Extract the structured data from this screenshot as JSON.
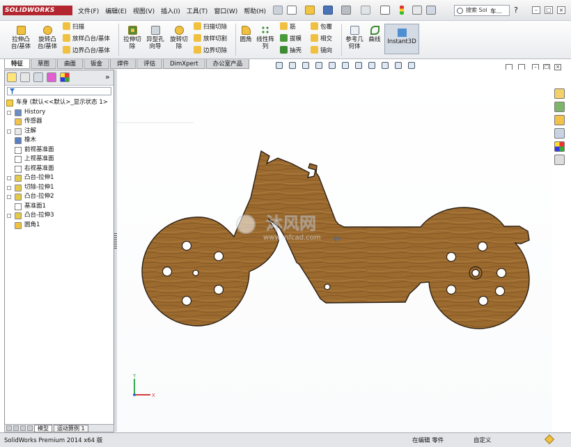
{
  "app": {
    "logo": "SOLIDWORKS",
    "menus": [
      "文件(F)",
      "编辑(E)",
      "视图(V)",
      "插入(I)",
      "工具(T)",
      "窗口(W)",
      "帮助(H)"
    ],
    "search_placeholder": "搜索 Sol",
    "extra_label": "车..."
  },
  "toolbar": {
    "extrude_boss": "拉伸凸\n台/基体",
    "revolve_boss": "旋转凸\n台/基体",
    "sweep": "扫描",
    "loft_boss": "放样凸台/基体",
    "boundary_boss": "边界凸台/基体",
    "extrude_cut": "拉伸切\n除",
    "hole_wizard": "异型孔\n向导",
    "revolve_cut": "旋转切\n除",
    "sweep_cut": "扫描切除",
    "loft_cut": "放样切割",
    "boundary_cut": "边界切除",
    "fillet": "圆角",
    "linear_pattern": "线性阵\n列",
    "rib": "筋",
    "draft": "拔模",
    "shell": "抽壳",
    "wrap": "包覆",
    "intersect": "相交",
    "mirror": "镜向",
    "ref_geometry": "参考几\n何体",
    "curves": "曲线",
    "instant3d": "Instant3D"
  },
  "tabs": [
    {
      "label": "特征",
      "active": true
    },
    {
      "label": "草图",
      "active": false
    },
    {
      "label": "曲面",
      "active": false
    },
    {
      "label": "钣金",
      "active": false
    },
    {
      "label": "焊件",
      "active": false
    },
    {
      "label": "评估",
      "active": false
    },
    {
      "label": "DimXpert",
      "active": false
    },
    {
      "label": "办公室产品",
      "active": false
    }
  ],
  "tree": {
    "root": "车身 (默认<<默认>_显示状态 1>",
    "items": [
      {
        "label": "History",
        "expand": true,
        "icon": "history-icon",
        "color": "#6a8ec4"
      },
      {
        "label": "传感器",
        "expand": false,
        "icon": "sensor-icon",
        "color": "#f2c24a"
      },
      {
        "label": "注解",
        "expand": true,
        "icon": "annotation-icon",
        "color": "#e8e8e8"
      },
      {
        "label": "橡木",
        "expand": false,
        "icon": "material-icon",
        "color": "#5a7fc2"
      },
      {
        "label": "前视基准面",
        "expand": false,
        "icon": "plane-icon",
        "color": "#ffffff"
      },
      {
        "label": "上视基准面",
        "expand": false,
        "icon": "plane-icon",
        "color": "#ffffff"
      },
      {
        "label": "右视基准面",
        "expand": false,
        "icon": "plane-icon",
        "color": "#ffffff"
      },
      {
        "label": "凸台-拉伸1",
        "expand": true,
        "icon": "extrude-icon",
        "color": "#e3c94c"
      },
      {
        "label": "切除-拉伸1",
        "expand": true,
        "icon": "cut-extrude-icon",
        "color": "#e3c94c"
      },
      {
        "label": "凸台-拉伸2",
        "expand": true,
        "icon": "extrude-icon",
        "color": "#e3c94c"
      },
      {
        "label": "基准面1",
        "expand": false,
        "icon": "plane-icon",
        "color": "#ffffff"
      },
      {
        "label": "凸台-拉伸3",
        "expand": true,
        "icon": "extrude-icon",
        "color": "#e3c94c"
      },
      {
        "label": "圆角1",
        "expand": false,
        "icon": "fillet-icon",
        "color": "#f0c13a"
      }
    ]
  },
  "panel_bottom": {
    "model_tab": "模型",
    "motion_tab": "运动算例 1"
  },
  "watermark": {
    "brand": "沐风网",
    "url": "www.mfcad.com"
  },
  "triad": {
    "y": "Y",
    "x": "X"
  },
  "status": {
    "product": "SolidWorks Premium 2014 x64 版",
    "mode": "在编辑 零件",
    "units": "自定义"
  },
  "colors": {
    "wood": "#9a6a2e",
    "brand_red": "#b3262f",
    "accent_blue": "#2c6fc4"
  }
}
